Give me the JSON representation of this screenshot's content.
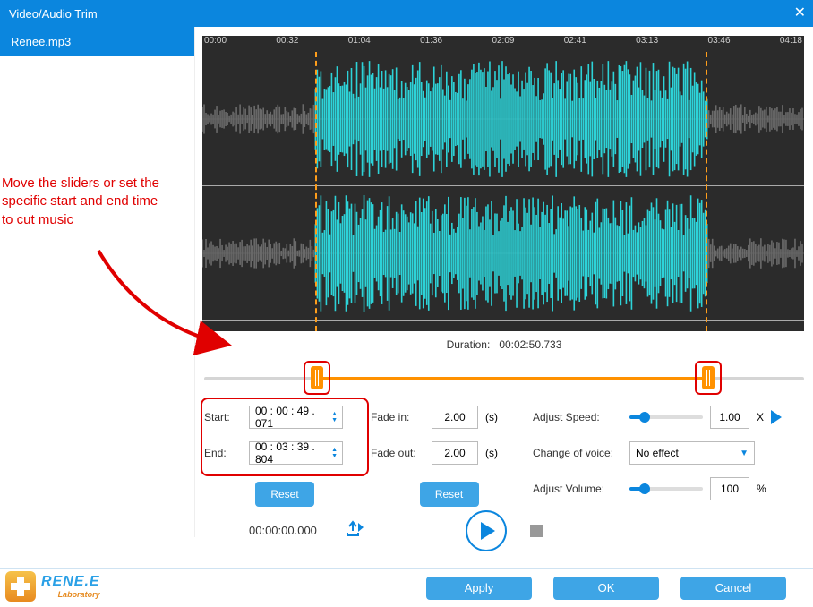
{
  "title": "Video/Audio Trim",
  "sidebar": {
    "file": "Renee.mp3"
  },
  "ruler": [
    "00:00",
    "00:32",
    "01:04",
    "01:36",
    "02:09",
    "02:41",
    "03:13",
    "03:46",
    "04:18"
  ],
  "annotation": "Move the sliders or set the specific start and end time to cut music",
  "duration_label": "Duration:",
  "duration_value": "00:02:50.733",
  "trim": {
    "start_label": "Start:",
    "start_value": "00 : 00 : 49 . 071",
    "end_label": "End:",
    "end_value": "00 : 03 : 39 . 804",
    "reset": "Reset"
  },
  "fade": {
    "in_label": "Fade in:",
    "in_value": "2.00",
    "out_label": "Fade out:",
    "out_value": "2.00",
    "unit": "(s)",
    "reset": "Reset"
  },
  "adjust": {
    "speed_label": "Adjust Speed:",
    "speed_value": "1.00",
    "speed_unit": "X",
    "voice_label": "Change of voice:",
    "voice_value": "No effect",
    "volume_label": "Adjust Volume:",
    "volume_value": "100",
    "volume_unit": "%"
  },
  "playback": {
    "time": "00:00:00.000"
  },
  "logo": {
    "brand": "RENE.E",
    "sub": "Laboratory"
  },
  "footer": {
    "apply": "Apply",
    "ok": "OK",
    "cancel": "Cancel"
  },
  "slider": {
    "start_pct": 18.8,
    "end_pct": 84.0
  }
}
